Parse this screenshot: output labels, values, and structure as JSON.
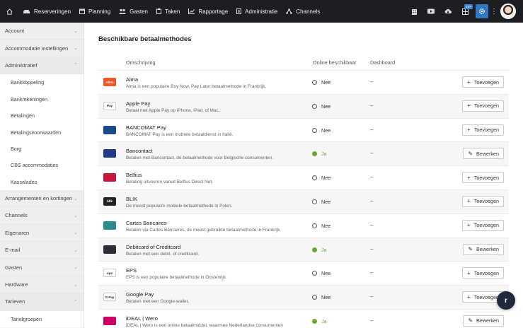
{
  "nav": {
    "items": [
      {
        "label": "Reserveringen",
        "icon": "car-icon"
      },
      {
        "label": "Planning",
        "icon": "calendar-icon"
      },
      {
        "label": "Gasten",
        "icon": "users-icon"
      },
      {
        "label": "Taken",
        "icon": "clipboard-icon"
      },
      {
        "label": "Rapportage",
        "icon": "chart-icon"
      },
      {
        "label": "Administratie",
        "icon": "document-icon"
      },
      {
        "label": "Channels",
        "icon": "share-icon"
      }
    ],
    "badge": "10+"
  },
  "sidebar": {
    "items": [
      {
        "label": "Account"
      },
      {
        "label": "Accommodatie instellingen"
      },
      {
        "label": "Administratief"
      },
      {
        "label": "Arrangementen en kortingen"
      },
      {
        "label": "Channels"
      },
      {
        "label": "Eigenaren"
      },
      {
        "label": "E-mail"
      },
      {
        "label": "Gasten"
      },
      {
        "label": "Hardware"
      },
      {
        "label": "Tarieven"
      }
    ],
    "admin_sub": [
      "Bankkoppeling",
      "Bankrekeningen",
      "Betalingen",
      "Betalingsvoorwaarden",
      "Borg",
      "CBS accommodaties",
      "Kassalades"
    ],
    "tarieven_sub": [
      "Tariefgroepen"
    ]
  },
  "main": {
    "title": "Beschikbare betaalmethodes",
    "headers": {
      "description": "Omschrijving",
      "online": "Online beschikbaar",
      "dashboard": "Dashboard"
    },
    "rows": [
      {
        "name": "Alma",
        "desc": "Alma is een populaire Buy Now, Pay Later betaalmethode in Frankrijk.",
        "status": "Nee",
        "dash": "–",
        "action": "Toevoegen",
        "logo_text": "Alma",
        "logo_color": "#f0562b"
      },
      {
        "name": "Apple Pay",
        "desc": "Betaal met Apple Pay op iPhone, iPad, of Mac.",
        "status": "Nee",
        "dash": "–",
        "action": "Toevoegen",
        "logo_text": "Pay",
        "logo_color": "#ffffff"
      },
      {
        "name": "BANCOMAT Pay",
        "desc": "BANCOMAT Pay is een mobiele betaaldienst in Italië.",
        "status": "Nee",
        "dash": "–",
        "action": "Toevoegen",
        "logo_text": "",
        "logo_color": "#1b4a8c"
      },
      {
        "name": "Bancontact",
        "desc": "Betalen met Bancontact, dé betaalmethode voor Belgische consumenten.",
        "status": "Ja",
        "dash": "–",
        "action": "Bewerken",
        "logo_text": "",
        "logo_color": "#1e3a8a"
      },
      {
        "name": "Belfius",
        "desc": "Betaling uitvoeren vanuit Belfius Direct Net.",
        "status": "Nee",
        "dash": "–",
        "action": "Toevoegen",
        "logo_text": "",
        "logo_color": "#c6173f"
      },
      {
        "name": "BLIK",
        "desc": "De meest populaire mobiele betaalmethode in Polen.",
        "status": "Nee",
        "dash": "–",
        "action": "Toevoegen",
        "logo_text": "blik",
        "logo_color": "#222222"
      },
      {
        "name": "Cartes Bancaires",
        "desc": "Betalen via Cartes Bancaires, de meest gebruikte betaalmethode in Frankrijk.",
        "status": "Nee",
        "dash": "–",
        "action": "Toevoegen",
        "logo_text": "",
        "logo_color": "#2a8c8c"
      },
      {
        "name": "Debitcard of Creditcard",
        "desc": "Betalen met een debit- of creditcard.",
        "status": "Ja",
        "dash": "–",
        "action": "Bewerken",
        "logo_text": "",
        "logo_color": "#2c2c3a"
      },
      {
        "name": "EPS",
        "desc": "EPS is een populaire betaalmethode in Oostenrijk.",
        "status": "Nee",
        "dash": "–",
        "action": "Toevoegen",
        "logo_text": "eps",
        "logo_color": "#ffffff"
      },
      {
        "name": "Google Pay",
        "desc": "Betalen met een Google-wallet.",
        "status": "Nee",
        "dash": "–",
        "action": "Toevoegen",
        "logo_text": "G Pay",
        "logo_color": "#ffffff"
      },
      {
        "name": "iDEAL | Wero",
        "desc": "iDEAL | Wero is een online betaalmiddel, waarmee Nederlandse consumenten",
        "status": "Ja",
        "dash": "–",
        "action": "Bewerken",
        "logo_text": "",
        "logo_color": "#cc0066"
      }
    ]
  },
  "chat": {
    "label": "r"
  },
  "colors": {
    "topbar": "#1d1e22",
    "accent": "#2f79c0",
    "yes": "#69a831"
  }
}
